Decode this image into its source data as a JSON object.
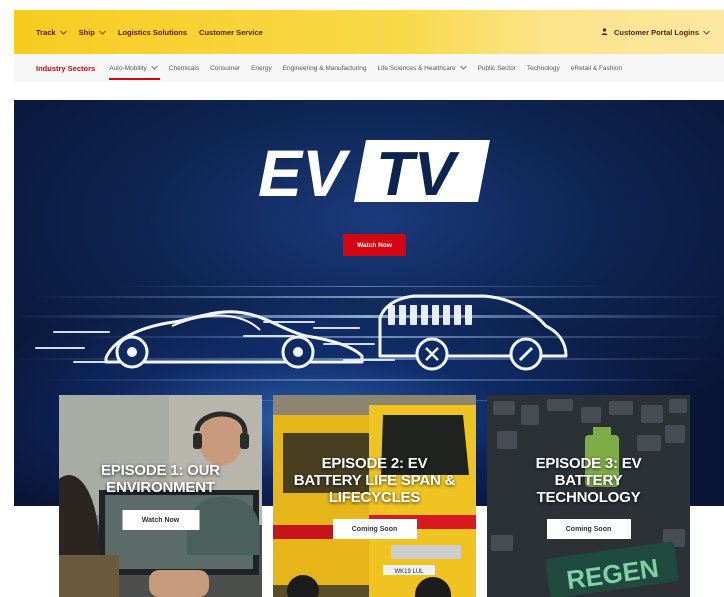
{
  "topnav": {
    "items": [
      {
        "label": "Track",
        "has_dropdown": true
      },
      {
        "label": "Ship",
        "has_dropdown": true
      },
      {
        "label": "Logistics Solutions",
        "has_dropdown": false
      },
      {
        "label": "Customer Service",
        "has_dropdown": false
      }
    ],
    "portal_label": "Customer Portal Logins",
    "portal_icon": "user-icon"
  },
  "sectors": {
    "title": "Industry Sectors",
    "items": [
      {
        "label": "Auto-Mobility",
        "active": true,
        "has_dropdown": true
      },
      {
        "label": "Chemicals"
      },
      {
        "label": "Consumer"
      },
      {
        "label": "Energy"
      },
      {
        "label": "Engineering & Manufacturing"
      },
      {
        "label": "Life Sciences & Healthcare",
        "has_dropdown": true
      },
      {
        "label": "Public Sector"
      },
      {
        "label": "Technology"
      },
      {
        "label": "eRetail & Fashion"
      }
    ]
  },
  "hero": {
    "logo_left": "EV",
    "logo_right": "TV",
    "cta_label": "Watch Now"
  },
  "episodes": [
    {
      "title_line1": "EPISODE 1: OUR",
      "title_line2": "ENVIRONMENT",
      "title_line3": "",
      "button": "Watch Now"
    },
    {
      "title_line1": "EPISODE 2: EV",
      "title_line2": "BATTERY LIFE SPAN &",
      "title_line3": "LIFECYCLES",
      "button": "Coming Soon"
    },
    {
      "title_line1": "EPISODE 3: EV",
      "title_line2": "BATTERY",
      "title_line3": "TECHNOLOGY",
      "button": "Coming Soon"
    }
  ],
  "episode3_sign_text": "REGEN",
  "van_plate_text": "WK19 LUL",
  "colors": {
    "brand_yellow": "#FFCC00",
    "brand_red": "#D40511",
    "hero_navy": "#0d2350"
  }
}
